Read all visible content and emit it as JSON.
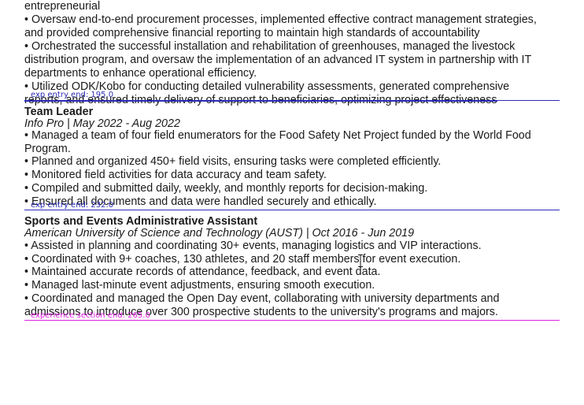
{
  "prev_entry": {
    "lines": [
      "entrepreneurial",
      "• Oversaw end-to-end procurement processes, implemented effective contract management strategies,",
      "and provided comprehensive financial reporting to maintain high standards of accountability",
      "• Orchestrated the successful installation and rehabilitation of greenhouses, managed the livestock",
      "distribution program, and oversaw the implementation of an advanced IT system in partnership with IT",
      "departments to enhance operational efficiency.",
      "• Utilized ODK/Kobo for conducting detailed vulnerability assessments, generated comprehensive",
      "reports, and ensured timely delivery of support to beneficiaries, optimizing project effectiveness"
    ],
    "marker_label": "exp entry end: 195.0"
  },
  "team_leader": {
    "title": "Team Leader",
    "subtitle": "Info Pro | May 2022 - Aug 2022",
    "lines": [
      "• Managed a team of four field enumerators for the Food Safety Net Project funded by the World Food",
      "Program.",
      "• Planned and organized 450+ field visits, ensuring tasks were completed efficiently.",
      "• Monitored field activities for data accuracy and team safety.",
      "• Compiled and submitted daily, weekly, and monthly reports for decision-making.",
      "• Ensured all documents and data were handled securely and ethically."
    ],
    "marker_label": "exp entry end: 232.0"
  },
  "sports_admin": {
    "title": "Sports and Events Administrative Assistant",
    "subtitle": "American University of Science and Technology (AUST) | Oct 2016 - Jun 2019",
    "lines": [
      "• Assisted in planning and coordinating 30+ events, managing logistics and VIP interactions.",
      "• Coordinated with 9+ coaches, 130 athletes, and 20 staff members for event execution.",
      "• Maintained accurate records of attendance, feedback, and event data.",
      "• Managed last-minute event adjustments, ensuring smooth execution.",
      "• Coordinated and managed the Open Day event, collaborating with university departments and",
      "admissions to introduce over 300 prospective students to the university's programs and majors."
    ],
    "marker_label": "experience section end: 265.0"
  },
  "colors": {
    "entry_marker": "#2b2bb8",
    "section_marker": "#e020e0"
  }
}
